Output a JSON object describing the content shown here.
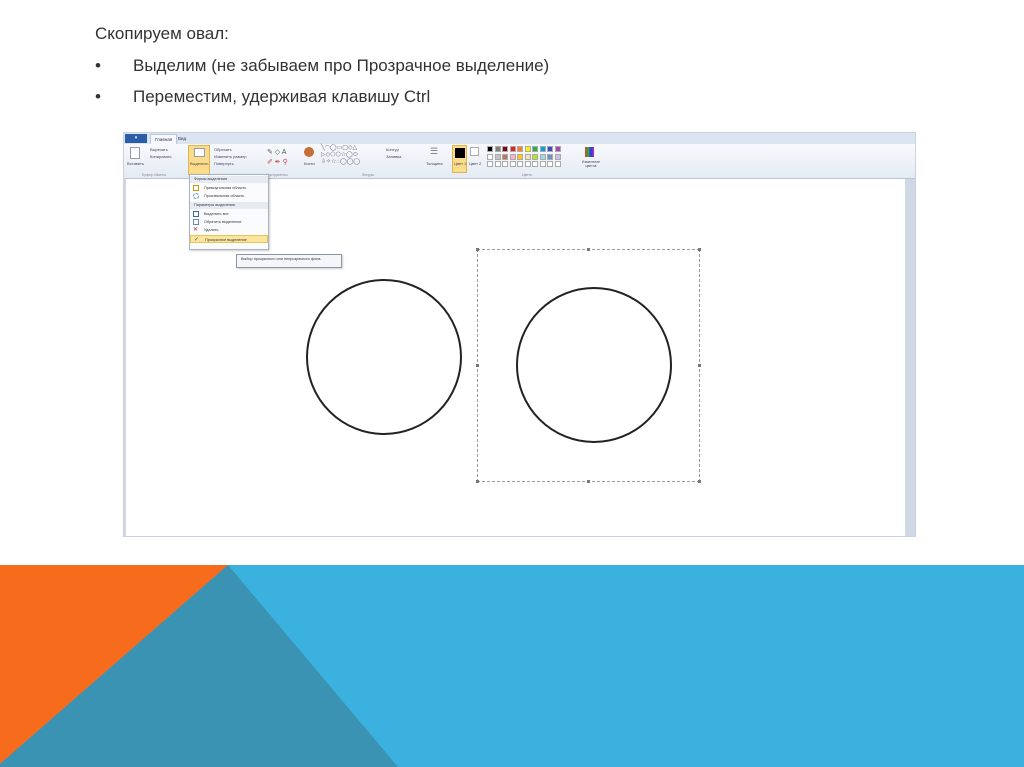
{
  "slide": {
    "title": "Скопируем овал:",
    "bullets": [
      "Выделим (не забываем про Прозрачное выделение)",
      "Переместим, удерживая клавишу Ctrl"
    ],
    "bullet_symbol": "•",
    "colors": {
      "orange": "#F76B1C",
      "teal": "#3A93B3",
      "blue": "#3AB1DF"
    }
  },
  "paint": {
    "tabs": [
      "Главная",
      "Вид"
    ],
    "ribbon": {
      "paste": "Вставить",
      "cut": "Вырезать",
      "copy": "Копировать",
      "clipboard_group": "Буфер обмена",
      "select": "Выделить",
      "crop": "Обрезать",
      "resize": "Изменить размер",
      "rotate": "Повернуть",
      "tools_group": "Инструменты",
      "brushes": "Кисти",
      "shapes_group": "Фигуры",
      "outline": "Контур",
      "fill": "Заливка",
      "size": "Толщина",
      "color1": "Цвет 1",
      "color2": "Цвет 2",
      "edit_colors": "Изменение цветов",
      "colors_group": "Цвета"
    },
    "palette": [
      "#000000",
      "#7f7f7f",
      "#880015",
      "#ed1c24",
      "#ff7f27",
      "#fff200",
      "#22b14c",
      "#00a2e8",
      "#3f48cc",
      "#a349a4",
      "#ffffff",
      "#c3c3c3",
      "#b97a57",
      "#ffaec9",
      "#ffc90e",
      "#efe4b0",
      "#b5e61d",
      "#99d9ea",
      "#7092be",
      "#c8bfe7"
    ],
    "select_menu": {
      "header1": "Формы выделения",
      "items1": [
        "Прямоугольная область",
        "Произвольная область"
      ],
      "header2": "Параметры выделения",
      "items2": [
        "Выделить все",
        "Обратить выделение",
        "Удалить",
        "Прозрачное выделение"
      ]
    },
    "tooltip": "Выбор прозрачного или непрозрачного фона."
  }
}
